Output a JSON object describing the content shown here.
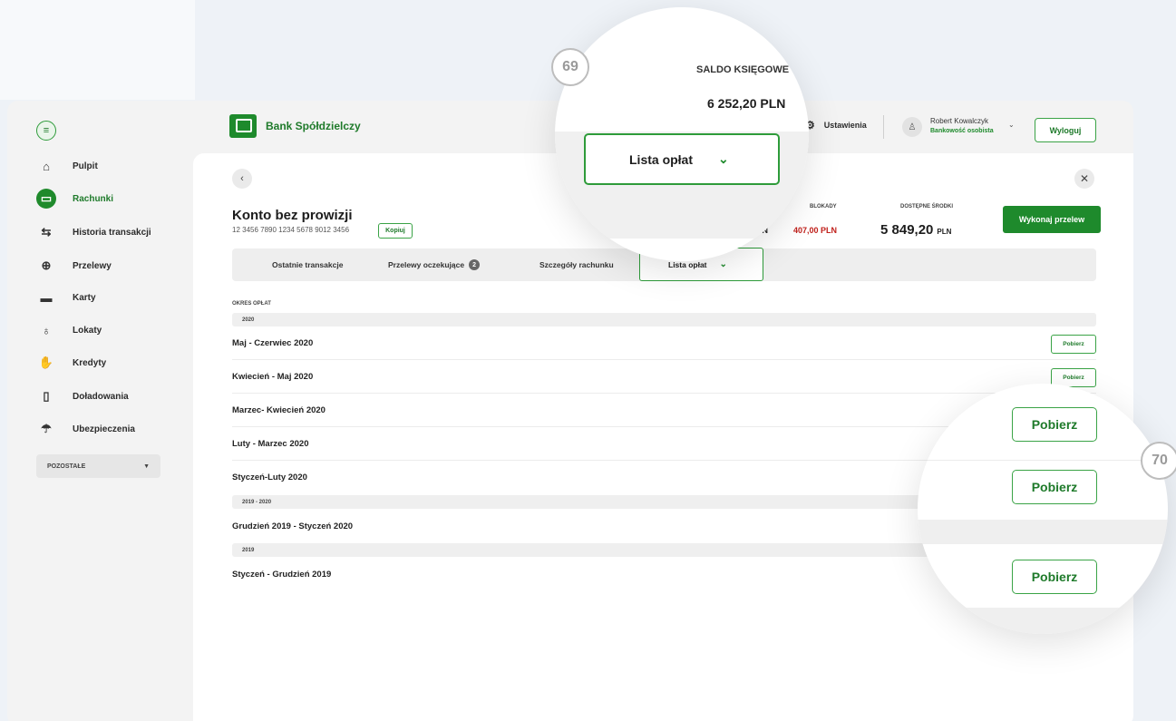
{
  "header": {
    "bank_name": "Bank Spółdzielczy",
    "settings_label": "Ustawienia",
    "user_name": "Robert Kowalczyk",
    "user_role": "Bankowość osobista",
    "logout_label": "Wyloguj"
  },
  "sidebar": {
    "items": [
      {
        "label": "Pulpit",
        "icon": "home-icon"
      },
      {
        "label": "Rachunki",
        "icon": "wallet-icon"
      },
      {
        "label": "Historia transakcji",
        "icon": "swap-icon"
      },
      {
        "label": "Przelewy",
        "icon": "arrow-right-circle-icon"
      },
      {
        "label": "Karty",
        "icon": "card-icon"
      },
      {
        "label": "Lokaty",
        "icon": "piggy-bank-icon"
      },
      {
        "label": "Kredyty",
        "icon": "hand-coins-icon"
      },
      {
        "label": "Doładowania",
        "icon": "phone-icon"
      },
      {
        "label": "Ubezpieczenia",
        "icon": "umbrella-icon"
      }
    ],
    "active_index": 1,
    "other_label": "POZOSTAŁE"
  },
  "account": {
    "title": "Konto bez prowizji",
    "iban": "12 3456 7890 1234 5678 9012 3456",
    "copy_label": "Kopiuj",
    "blocked_label": "BLOKADY",
    "blocked_value": "407,00 PLN",
    "available_label": "DOSTĘPNE ŚRODKI",
    "available_value": "5 849,20",
    "available_currency": "PLN",
    "partial_value": "LN",
    "transfer_label": "Wykonaj przelew"
  },
  "tabs": {
    "recent": "Ostatnie transakcje",
    "pending": "Przelewy oczekujące",
    "pending_count": "2",
    "details": "Szczegóły rachunku",
    "fees": "Lista opłat"
  },
  "fees": {
    "period_label": "OKRES OPŁAT",
    "download_label": "Pobierz",
    "groups": [
      {
        "year": "2020",
        "items": [
          "Maj - Czerwiec 2020",
          "Kwiecień - Maj 2020",
          "Marzec- Kwiecień 2020",
          "Luty - Marzec 2020",
          "Styczeń-Luty 2020"
        ]
      },
      {
        "year": "2019 - 2020",
        "items": [
          "Grudzień 2019 - Styczeń 2020"
        ]
      },
      {
        "year": "2019",
        "items": [
          "Styczeń - Grudzień 2019"
        ]
      }
    ]
  },
  "zoom1": {
    "label": "SALDO KSIĘGOWE",
    "value": "6 252,20 PLN",
    "select_label": "Lista opłat",
    "step": "69"
  },
  "zoom2": {
    "button_label": "Pobierz",
    "step": "70"
  },
  "colors": {
    "brand": "#1e8a2c",
    "danger": "#c0201b"
  }
}
